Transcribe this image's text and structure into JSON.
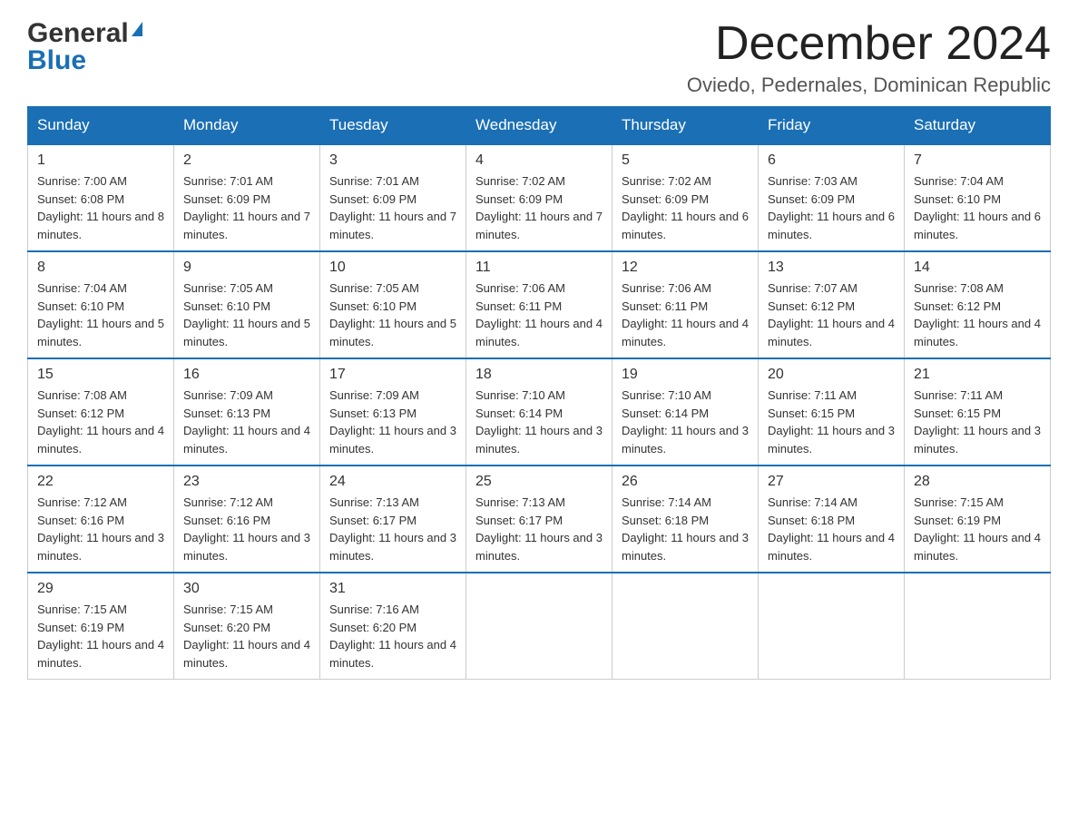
{
  "logo": {
    "text_general": "General",
    "text_blue": "Blue"
  },
  "header": {
    "month_year": "December 2024",
    "location": "Oviedo, Pedernales, Dominican Republic"
  },
  "weekdays": [
    "Sunday",
    "Monday",
    "Tuesday",
    "Wednesday",
    "Thursday",
    "Friday",
    "Saturday"
  ],
  "weeks": [
    [
      {
        "day": "1",
        "sunrise": "7:00 AM",
        "sunset": "6:08 PM",
        "daylight": "11 hours and 8 minutes."
      },
      {
        "day": "2",
        "sunrise": "7:01 AM",
        "sunset": "6:09 PM",
        "daylight": "11 hours and 7 minutes."
      },
      {
        "day": "3",
        "sunrise": "7:01 AM",
        "sunset": "6:09 PM",
        "daylight": "11 hours and 7 minutes."
      },
      {
        "day": "4",
        "sunrise": "7:02 AM",
        "sunset": "6:09 PM",
        "daylight": "11 hours and 7 minutes."
      },
      {
        "day": "5",
        "sunrise": "7:02 AM",
        "sunset": "6:09 PM",
        "daylight": "11 hours and 6 minutes."
      },
      {
        "day": "6",
        "sunrise": "7:03 AM",
        "sunset": "6:09 PM",
        "daylight": "11 hours and 6 minutes."
      },
      {
        "day": "7",
        "sunrise": "7:04 AM",
        "sunset": "6:10 PM",
        "daylight": "11 hours and 6 minutes."
      }
    ],
    [
      {
        "day": "8",
        "sunrise": "7:04 AM",
        "sunset": "6:10 PM",
        "daylight": "11 hours and 5 minutes."
      },
      {
        "day": "9",
        "sunrise": "7:05 AM",
        "sunset": "6:10 PM",
        "daylight": "11 hours and 5 minutes."
      },
      {
        "day": "10",
        "sunrise": "7:05 AM",
        "sunset": "6:10 PM",
        "daylight": "11 hours and 5 minutes."
      },
      {
        "day": "11",
        "sunrise": "7:06 AM",
        "sunset": "6:11 PM",
        "daylight": "11 hours and 4 minutes."
      },
      {
        "day": "12",
        "sunrise": "7:06 AM",
        "sunset": "6:11 PM",
        "daylight": "11 hours and 4 minutes."
      },
      {
        "day": "13",
        "sunrise": "7:07 AM",
        "sunset": "6:12 PM",
        "daylight": "11 hours and 4 minutes."
      },
      {
        "day": "14",
        "sunrise": "7:08 AM",
        "sunset": "6:12 PM",
        "daylight": "11 hours and 4 minutes."
      }
    ],
    [
      {
        "day": "15",
        "sunrise": "7:08 AM",
        "sunset": "6:12 PM",
        "daylight": "11 hours and 4 minutes."
      },
      {
        "day": "16",
        "sunrise": "7:09 AM",
        "sunset": "6:13 PM",
        "daylight": "11 hours and 4 minutes."
      },
      {
        "day": "17",
        "sunrise": "7:09 AM",
        "sunset": "6:13 PM",
        "daylight": "11 hours and 3 minutes."
      },
      {
        "day": "18",
        "sunrise": "7:10 AM",
        "sunset": "6:14 PM",
        "daylight": "11 hours and 3 minutes."
      },
      {
        "day": "19",
        "sunrise": "7:10 AM",
        "sunset": "6:14 PM",
        "daylight": "11 hours and 3 minutes."
      },
      {
        "day": "20",
        "sunrise": "7:11 AM",
        "sunset": "6:15 PM",
        "daylight": "11 hours and 3 minutes."
      },
      {
        "day": "21",
        "sunrise": "7:11 AM",
        "sunset": "6:15 PM",
        "daylight": "11 hours and 3 minutes."
      }
    ],
    [
      {
        "day": "22",
        "sunrise": "7:12 AM",
        "sunset": "6:16 PM",
        "daylight": "11 hours and 3 minutes."
      },
      {
        "day": "23",
        "sunrise": "7:12 AM",
        "sunset": "6:16 PM",
        "daylight": "11 hours and 3 minutes."
      },
      {
        "day": "24",
        "sunrise": "7:13 AM",
        "sunset": "6:17 PM",
        "daylight": "11 hours and 3 minutes."
      },
      {
        "day": "25",
        "sunrise": "7:13 AM",
        "sunset": "6:17 PM",
        "daylight": "11 hours and 3 minutes."
      },
      {
        "day": "26",
        "sunrise": "7:14 AM",
        "sunset": "6:18 PM",
        "daylight": "11 hours and 3 minutes."
      },
      {
        "day": "27",
        "sunrise": "7:14 AM",
        "sunset": "6:18 PM",
        "daylight": "11 hours and 4 minutes."
      },
      {
        "day": "28",
        "sunrise": "7:15 AM",
        "sunset": "6:19 PM",
        "daylight": "11 hours and 4 minutes."
      }
    ],
    [
      {
        "day": "29",
        "sunrise": "7:15 AM",
        "sunset": "6:19 PM",
        "daylight": "11 hours and 4 minutes."
      },
      {
        "day": "30",
        "sunrise": "7:15 AM",
        "sunset": "6:20 PM",
        "daylight": "11 hours and 4 minutes."
      },
      {
        "day": "31",
        "sunrise": "7:16 AM",
        "sunset": "6:20 PM",
        "daylight": "11 hours and 4 minutes."
      },
      null,
      null,
      null,
      null
    ]
  ],
  "labels": {
    "sunrise_prefix": "Sunrise: ",
    "sunset_prefix": "Sunset: ",
    "daylight_prefix": "Daylight: "
  }
}
